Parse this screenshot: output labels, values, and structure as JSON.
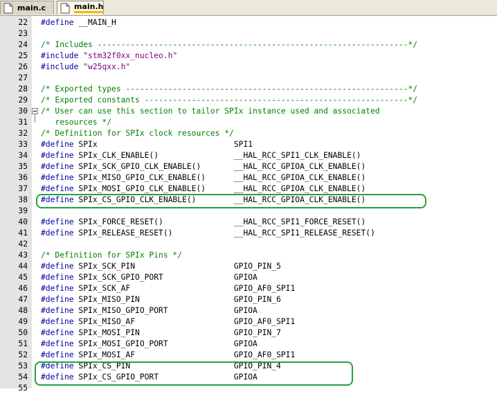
{
  "tabs": [
    {
      "label": "main.c",
      "active": false
    },
    {
      "label": "main.h",
      "active": true
    }
  ],
  "colors": {
    "comment": "#008000",
    "directive": "#0000a0",
    "string": "#800080",
    "highlight": "#22a040"
  },
  "lines": [
    {
      "num": "22",
      "text": "#define __MAIN_H"
    },
    {
      "num": "23",
      "text": ""
    },
    {
      "num": "24",
      "text": "/* Includes ------------------------------------------------------------------*/"
    },
    {
      "num": "25",
      "text": "#include \"stm32f0xx_nucleo.h\""
    },
    {
      "num": "26",
      "text": "#include \"w25qxx.h\""
    },
    {
      "num": "27",
      "text": ""
    },
    {
      "num": "28",
      "text": "/* Exported types ------------------------------------------------------------*/"
    },
    {
      "num": "29",
      "text": "/* Exported constants --------------------------------------------------------*/"
    },
    {
      "num": "30",
      "text": "/* User can use this section to tailor SPIx instance used and associated"
    },
    {
      "num": "31",
      "text": "   resources */"
    },
    {
      "num": "32",
      "text": "/* Definition for SPIx clock resources */"
    },
    {
      "num": "33",
      "text": "#define SPIx                             SPI1"
    },
    {
      "num": "34",
      "text": "#define SPIx_CLK_ENABLE()                __HAL_RCC_SPI1_CLK_ENABLE()"
    },
    {
      "num": "35",
      "text": "#define SPIx_SCK_GPIO_CLK_ENABLE()       __HAL_RCC_GPIOA_CLK_ENABLE()"
    },
    {
      "num": "36",
      "text": "#define SPIx_MISO_GPIO_CLK_ENABLE()      __HAL_RCC_GPIOA_CLK_ENABLE()"
    },
    {
      "num": "37",
      "text": "#define SPIx_MOSI_GPIO_CLK_ENABLE()      __HAL_RCC_GPIOA_CLK_ENABLE()"
    },
    {
      "num": "38",
      "text": "#define SPIx_CS_GPIO_CLK_ENABLE()        __HAL_RCC_GPIOA_CLK_ENABLE()"
    },
    {
      "num": "39",
      "text": ""
    },
    {
      "num": "40",
      "text": "#define SPIx_FORCE_RESET()               __HAL_RCC_SPI1_FORCE_RESET()"
    },
    {
      "num": "41",
      "text": "#define SPIx_RELEASE_RESET()             __HAL_RCC_SPI1_RELEASE_RESET()"
    },
    {
      "num": "42",
      "text": ""
    },
    {
      "num": "43",
      "text": "/* Definition for SPIx Pins */"
    },
    {
      "num": "44",
      "text": "#define SPIx_SCK_PIN                     GPIO_PIN_5"
    },
    {
      "num": "45",
      "text": "#define SPIx_SCK_GPIO_PORT               GPIOA"
    },
    {
      "num": "46",
      "text": "#define SPIx_SCK_AF                      GPIO_AF0_SPI1"
    },
    {
      "num": "47",
      "text": "#define SPIx_MISO_PIN                    GPIO_PIN_6"
    },
    {
      "num": "48",
      "text": "#define SPIx_MISO_GPIO_PORT              GPIOA"
    },
    {
      "num": "49",
      "text": "#define SPIx_MISO_AF                     GPIO_AF0_SPI1"
    },
    {
      "num": "50",
      "text": "#define SPIx_MOSI_PIN                    GPIO_PIN_7"
    },
    {
      "num": "51",
      "text": "#define SPIx_MOSI_GPIO_PORT              GPIOA"
    },
    {
      "num": "52",
      "text": "#define SPIx_MOSI_AF                     GPIO_AF0_SPI1"
    },
    {
      "num": "53",
      "text": "#define SPIx_CS_PIN                      GPIO_PIN_4"
    },
    {
      "num": "54",
      "text": "#define SPIx_CS_GPIO_PORT                GPIOA"
    },
    {
      "num": "55",
      "text": ""
    }
  ]
}
